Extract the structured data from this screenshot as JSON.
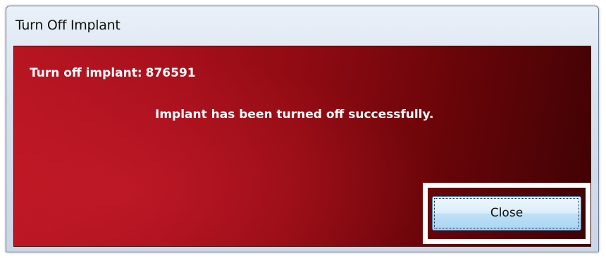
{
  "window": {
    "title": "Turn Off Implant"
  },
  "dialog": {
    "turn_off_label": "Turn off implant:",
    "implant_id": "876591",
    "message": "Implant has been turned off successfully.",
    "close_label": "Close"
  },
  "colors": {
    "dialog_background_start": "#b81522",
    "dialog_background_end": "#3f0204",
    "text": "#ffffff",
    "button_accent": "#bfe0f6"
  }
}
